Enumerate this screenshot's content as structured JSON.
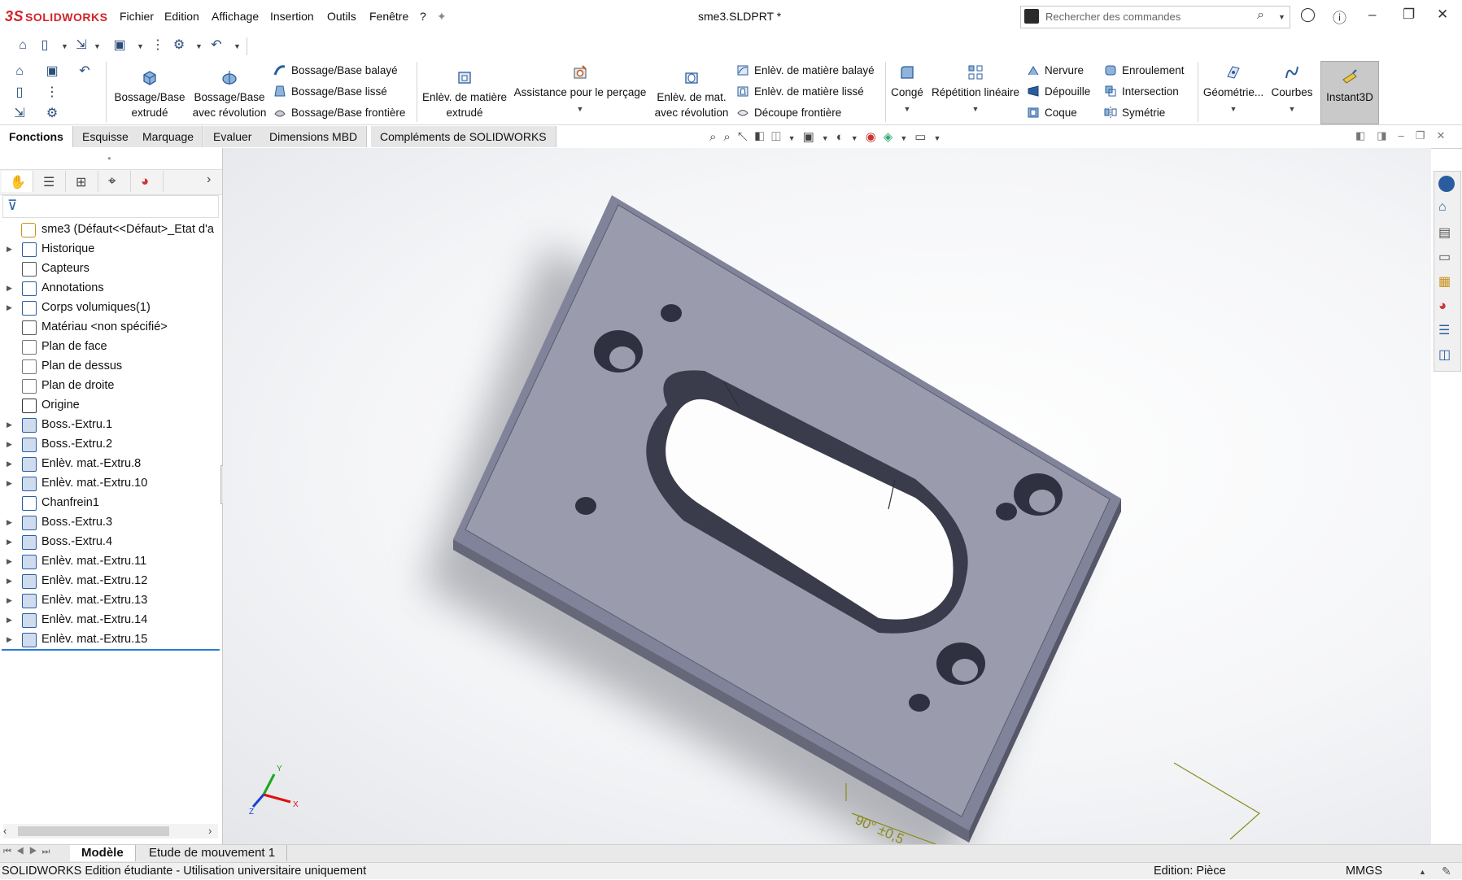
{
  "app": {
    "logo_text": "SOLIDWORKS",
    "doc_title": "sme3.SLDPRT *"
  },
  "menu": [
    "Fichier",
    "Edition",
    "Affichage",
    "Insertion",
    "Outils",
    "Fenêtre",
    "?"
  ],
  "search": {
    "placeholder": "Rechercher des commandes"
  },
  "ribbon": {
    "boss_extrude": [
      "Bossage/Base",
      "extrudé"
    ],
    "boss_revolve": [
      "Bossage/Base",
      "avec révolution"
    ],
    "boss_sweep": "Bossage/Base balayé",
    "boss_loft": "Bossage/Base lissé",
    "boss_boundary": "Bossage/Base frontière",
    "cut_extrude": [
      "Enlèv. de matière",
      "extrudé"
    ],
    "hole_wizard": "Assistance pour le perçage",
    "cut_revolve": [
      "Enlèv. de mat.",
      "avec révolution"
    ],
    "cut_sweep": "Enlèv. de matière balayé",
    "cut_loft": "Enlèv. de matière lissé",
    "cut_boundary": "Découpe frontière",
    "fillet": "Congé",
    "linear_pattern": "Répétition linéaire",
    "rib": "Nervure",
    "draft": "Dépouille",
    "shell": "Coque",
    "wrap": "Enroulement",
    "intersect": "Intersection",
    "mirror": "Symétrie",
    "ref_geometry": "Géométrie...",
    "curves": "Courbes",
    "instant3d": "Instant3D"
  },
  "tabs": [
    "Fonctions",
    "Esquisse",
    "Marquage",
    "Evaluer",
    "Dimensions MBD",
    "Compléments de SOLIDWORKS"
  ],
  "active_tab": "Fonctions",
  "tree": [
    {
      "label": "sme3  (Défaut<<Défaut>_Etat d'a",
      "expand": false,
      "icon": "part-icon"
    },
    {
      "label": "Historique",
      "expand": true,
      "icon": "history-icon"
    },
    {
      "label": "Capteurs",
      "expand": false,
      "icon": "sensor-icon"
    },
    {
      "label": "Annotations",
      "expand": true,
      "icon": "annotation-icon"
    },
    {
      "label": "Corps volumiques(1)",
      "expand": true,
      "icon": "folder-icon"
    },
    {
      "label": "Matériau <non spécifié>",
      "expand": false,
      "icon": "material-icon"
    },
    {
      "label": "Plan de face",
      "expand": false,
      "icon": "plane-icon"
    },
    {
      "label": "Plan de dessus",
      "expand": false,
      "icon": "plane-icon"
    },
    {
      "label": "Plan de droite",
      "expand": false,
      "icon": "plane-icon"
    },
    {
      "label": "Origine",
      "expand": false,
      "icon": "origin-icon"
    },
    {
      "label": "Boss.-Extru.1",
      "expand": true,
      "icon": "extrude-icon"
    },
    {
      "label": "Boss.-Extru.2",
      "expand": true,
      "icon": "extrude-icon"
    },
    {
      "label": "Enlèv. mat.-Extru.8",
      "expand": true,
      "icon": "cut-icon"
    },
    {
      "label": "Enlèv. mat.-Extru.10",
      "expand": true,
      "icon": "cut-icon"
    },
    {
      "label": "Chanfrein1",
      "expand": false,
      "icon": "chamfer-icon"
    },
    {
      "label": "Boss.-Extru.3",
      "expand": true,
      "icon": "extrude-icon"
    },
    {
      "label": "Boss.-Extru.4",
      "expand": true,
      "icon": "extrude-icon"
    },
    {
      "label": "Enlèv. mat.-Extru.11",
      "expand": true,
      "icon": "cut-icon"
    },
    {
      "label": "Enlèv. mat.-Extru.12",
      "expand": true,
      "icon": "cut-icon"
    },
    {
      "label": "Enlèv. mat.-Extru.13",
      "expand": true,
      "icon": "cut-icon"
    },
    {
      "label": "Enlèv. mat.-Extru.14",
      "expand": true,
      "icon": "cut-icon"
    },
    {
      "label": "Enlèv. mat.-Extru.15",
      "expand": true,
      "icon": "cut-icon"
    }
  ],
  "viewport": {
    "dimension_text": "90° ±0,5",
    "axis_x": "X",
    "axis_y": "Y",
    "axis_z": "Z"
  },
  "bottom_tabs": [
    "Modèle",
    "Etude de mouvement 1"
  ],
  "active_bottom_tab": "Modèle",
  "status": {
    "left": "SOLIDWORKS Edition étudiante - Utilisation universitaire uniquement",
    "mode": "Edition: Pièce",
    "units": "MMGS"
  },
  "colors": {
    "accent_red": "#d2232a",
    "part_face": "#9a9cae",
    "part_side": "#6d6f82",
    "icon_blue": "#2a5d9f"
  }
}
